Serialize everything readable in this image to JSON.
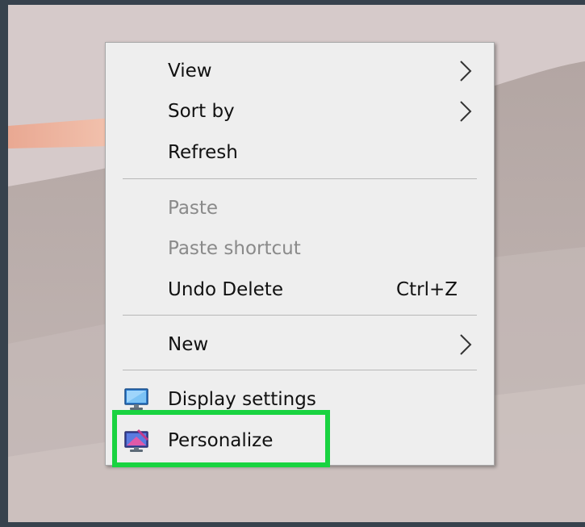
{
  "desktop": {
    "wallpaper": "sand-dunes",
    "frame_color": "#37424d"
  },
  "context_menu": {
    "items": [
      {
        "label": "View",
        "submenu": true,
        "icon": null,
        "disabled": false
      },
      {
        "label": "Sort by",
        "submenu": true,
        "icon": null,
        "disabled": false
      },
      {
        "label": "Refresh",
        "submenu": false,
        "icon": null,
        "disabled": false
      },
      {
        "label": "Paste",
        "submenu": false,
        "icon": null,
        "disabled": true
      },
      {
        "label": "Paste shortcut",
        "submenu": false,
        "icon": null,
        "disabled": true
      },
      {
        "label": "Undo Delete",
        "submenu": false,
        "shortcut": "Ctrl+Z",
        "icon": null,
        "disabled": false
      },
      {
        "label": "New",
        "submenu": true,
        "icon": null,
        "disabled": false
      },
      {
        "label": "Display settings",
        "submenu": false,
        "icon": "display-settings-icon",
        "disabled": false
      },
      {
        "label": "Personalize",
        "submenu": false,
        "icon": "personalize-icon",
        "disabled": false
      }
    ]
  },
  "highlight": {
    "target": "Personalize",
    "color": "#19d340"
  }
}
